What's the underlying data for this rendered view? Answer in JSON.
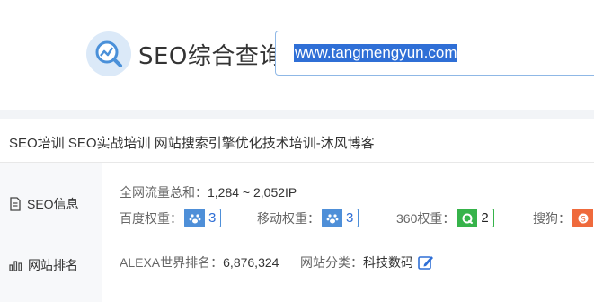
{
  "header": {
    "brand_title": "SEO综合查询",
    "search_value": "www.tangmengyun.com"
  },
  "site": {
    "title": "SEO培训 SEO实战培训 网站搜索引擎优化技术培训-沐风博客"
  },
  "seo_info": {
    "label": "SEO信息",
    "traffic_label": "全网流量总和：",
    "traffic_value": "1,284 ~ 2,052IP",
    "weights": [
      {
        "label": "百度权重：",
        "value": "3",
        "icon": "baidu-paw-icon"
      },
      {
        "label": "移动权重：",
        "value": "3",
        "icon": "baidu-paw-icon"
      },
      {
        "label": "360权重：",
        "value": "2",
        "icon": "360-icon"
      },
      {
        "label": "搜狗：",
        "value": "",
        "icon": "sogou-icon"
      }
    ]
  },
  "ranking": {
    "label": "网站排名",
    "alexa_label": "ALEXA世界排名：",
    "alexa_value": "6,876,324",
    "category_label": "网站分类：",
    "category_value": "科技数码",
    "edit_icon": "edit-icon"
  },
  "colors": {
    "accent": "#2f6fd6",
    "search_border": "#8fb8e6",
    "green": "#36b34a",
    "orange": "#ef6a3c"
  }
}
